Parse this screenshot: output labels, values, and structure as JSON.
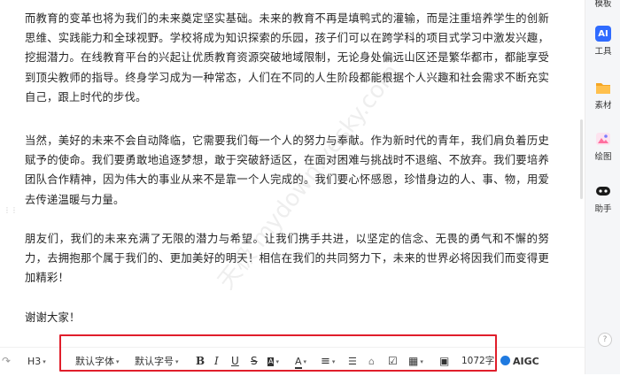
{
  "document": {
    "paragraphs": [
      "而教育的变革也将为我们的未来奠定坚实基础。未来的教育不再是填鸭式的灌输，而是注重培养学生的创新思维、实践能力和全球视野。学校将成为知识探索的乐园，孩子们可以在跨学科的项目式学习中激发兴趣，挖掘潜力。在线教育平台的兴起让优质教育资源突破地域限制，无论身处偏远山区还是繁华都市，都能享受到顶尖教师的指导。终身学习成为一种常态，人们在不同的人生阶段都能根据个人兴趣和社会需求不断充实自己，跟上时代的步伐。",
      "当然，美好的未来不会自动降临，它需要我们每一个人的努力与奉献。作为新时代的青年，我们肩负着历史赋予的使命。我们要勇敢地追逐梦想，敢于突破舒适区，在面对困难与挑战时不退缩、不放弃。我们要培养团队合作精神，因为伟大的事业从来不是靠一个人完成的。我们要心怀感恩，珍惜身边的人、事、物，用爱去传递温暖与力量。",
      "朋友们，我们的未来充满了无限的潜力与希望。让我们携手共进，以坚定的信念、无畏的勇气和不懈的努力，去拥抱那个属于我们的、更加美好的明天！相信在我们的共同努力下，未来的世界必将因我们而变得更加精彩！",
      "谢谢大家！"
    ],
    "watermark": "天极 mydown.yesky.com"
  },
  "sidebar": {
    "top_label": "模板",
    "items": [
      {
        "label": "工具",
        "icon": "ai-icon",
        "icon_text": "AI",
        "color": "#2f6bff"
      },
      {
        "label": "素材",
        "icon": "folder-icon",
        "icon_text": "",
        "color": "#f5a623"
      },
      {
        "label": "绘图",
        "icon": "image-icon",
        "icon_text": "",
        "color": "#ff7aa8"
      },
      {
        "label": "助手",
        "icon": "robot-icon",
        "icon_text": "",
        "color": "#1a1a1a"
      }
    ],
    "help": "?"
  },
  "toolbar": {
    "undo": "↷",
    "heading": "H3",
    "font_family": "默认字体",
    "font_size": "默认字号",
    "bold": "B",
    "italic": "I",
    "underline": "U",
    "strike": "S",
    "bg_color": "A",
    "font_color": "A",
    "align": "≡",
    "list": "☰",
    "clear_format": "⌂",
    "checkbox": "☑",
    "table": "▦",
    "image": "▣",
    "word_count": "1072字",
    "aigc": "AIGC",
    "caret": "▾"
  }
}
